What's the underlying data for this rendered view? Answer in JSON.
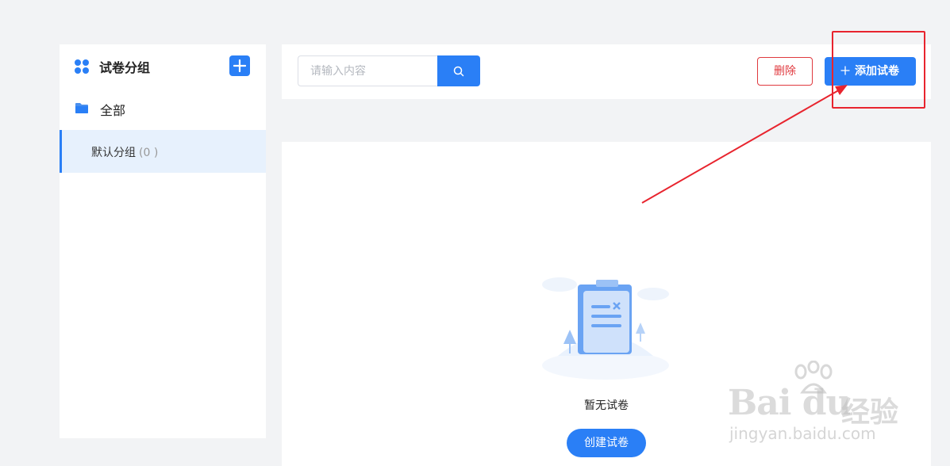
{
  "sidebar": {
    "title": "试卷分组",
    "all_label": "全部",
    "group": {
      "label": "默认分组",
      "count": "(0 )"
    }
  },
  "toolbar": {
    "search_placeholder": "请输入内容",
    "delete_label": "删除",
    "add_label": "添加试卷"
  },
  "content": {
    "empty_text": "暂无试卷",
    "create_label": "创建试卷"
  },
  "watermark": {
    "brand": "Bai du",
    "brand_cn": "经验",
    "url": "jingyan.baidu.com"
  },
  "colors": {
    "primary": "#2a7ff6",
    "danger": "#e0393e",
    "annotation": "#e8242e",
    "background": "#f2f3f5"
  }
}
